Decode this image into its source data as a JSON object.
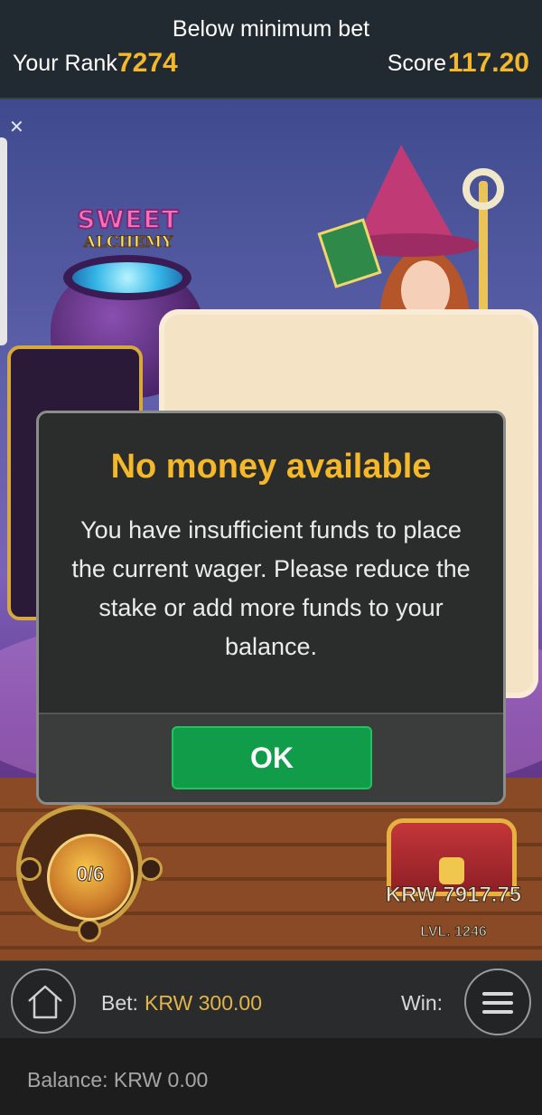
{
  "tournament": {
    "status": "Below minimum bet",
    "rank_label": "Your Rank",
    "rank_value": "7274",
    "score_label": "Score",
    "score_value": "117.20"
  },
  "game": {
    "logo_line1": "SWEET",
    "logo_line2": "ALCHEMY",
    "meter_count": "0/6",
    "chest_amount": "KRW 7917.75",
    "chest_level": "LVL. 1246"
  },
  "dialog": {
    "title": "No money available",
    "message": "You have insufficient funds to place the current wager. Please reduce the stake or add more funds to your balance.",
    "ok_label": "OK"
  },
  "bottom_bar": {
    "bet_label": "Bet:",
    "bet_value": "KRW 300.00",
    "win_label": "Win:",
    "balance_text": "Balance: KRW 0.00"
  },
  "icons": {
    "home": "home-icon",
    "menu": "hamburger-menu-icon",
    "close": "close-sparkle-icon"
  },
  "colors": {
    "accent_gold": "#f4b82a",
    "ok_green": "#109c48",
    "bet_value_gold": "#e2b54a"
  }
}
